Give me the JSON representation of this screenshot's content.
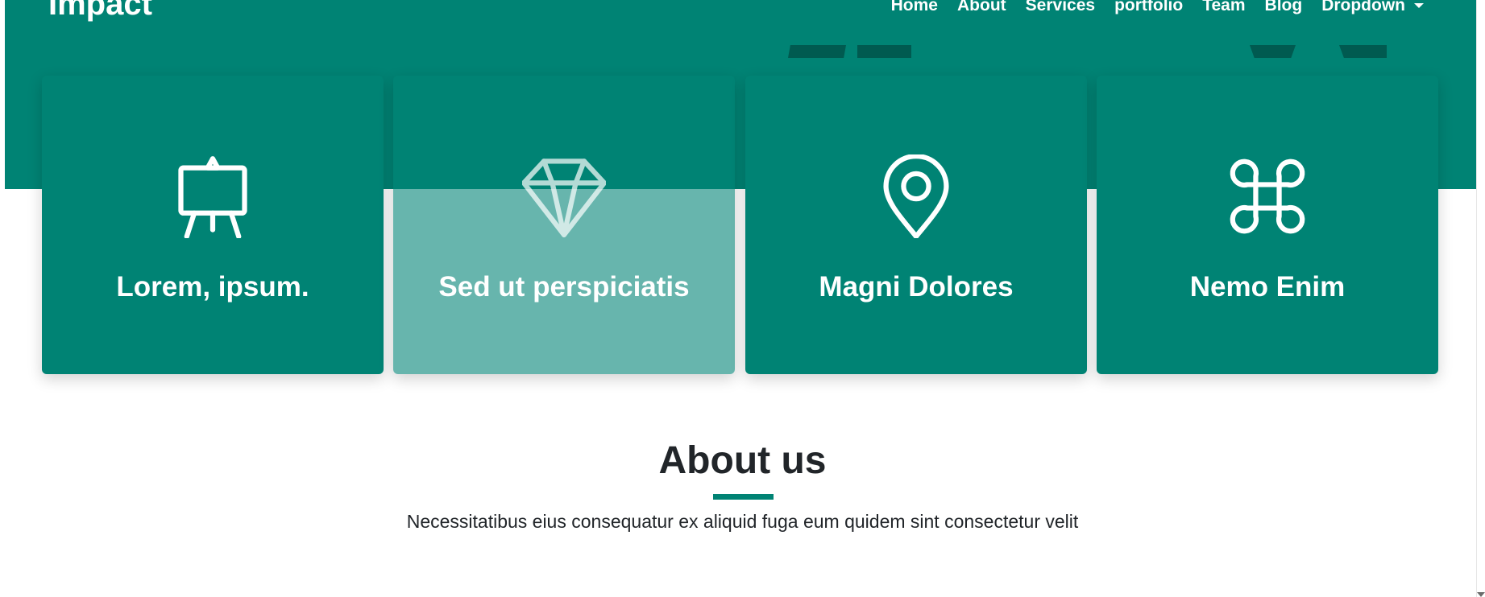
{
  "brand": {
    "logo": "Impact"
  },
  "nav": {
    "items": [
      {
        "label": "Home"
      },
      {
        "label": "About"
      },
      {
        "label": "Services"
      },
      {
        "label": "portfolio"
      },
      {
        "label": "Team"
      },
      {
        "label": "Blog"
      },
      {
        "label": "Dropdown"
      }
    ]
  },
  "cards": [
    {
      "title": "Lorem, ipsum.",
      "icon": "easel-icon"
    },
    {
      "title": "Sed ut perspiciatis",
      "icon": "gem-icon"
    },
    {
      "title": "Magni Dolores",
      "icon": "geo-alt-icon"
    },
    {
      "title": "Nemo Enim",
      "icon": "command-icon"
    }
  ],
  "about": {
    "title": "About us",
    "description": "Necessitatibus eius consequatur ex aliquid fuga eum quidem sint consectetur velit"
  },
  "colors": {
    "primary": "#008374",
    "card_hover": "#67b5ad",
    "decor_dark": "#005a50",
    "text_dark": "#212529",
    "white": "#ffffff"
  }
}
